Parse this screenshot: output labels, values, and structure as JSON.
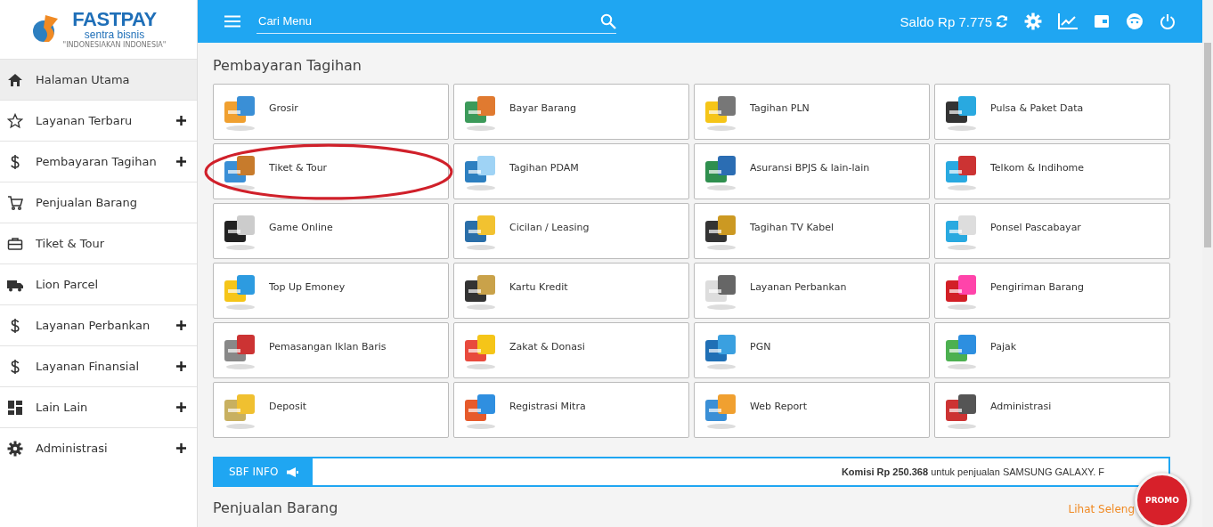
{
  "logo": {
    "name": "FASTPAY",
    "subtitle": "sentra bisnis",
    "tagline": "\"INDONESIAKAN INDONESIA\""
  },
  "sidebar": {
    "items": [
      {
        "label": "Halaman Utama",
        "selected": true,
        "expandable": false
      },
      {
        "label": "Layanan Terbaru",
        "selected": false,
        "expandable": true
      },
      {
        "label": "Pembayaran Tagihan",
        "selected": false,
        "expandable": true
      },
      {
        "label": "Penjualan Barang",
        "selected": false,
        "expandable": false
      },
      {
        "label": "Tiket & Tour",
        "selected": false,
        "expandable": false
      },
      {
        "label": "Lion Parcel",
        "selected": false,
        "expandable": false
      },
      {
        "label": "Layanan Perbankan",
        "selected": false,
        "expandable": true
      },
      {
        "label": "Layanan Finansial",
        "selected": false,
        "expandable": true
      },
      {
        "label": "Lain Lain",
        "selected": false,
        "expandable": true
      },
      {
        "label": "Administrasi",
        "selected": false,
        "expandable": true
      }
    ]
  },
  "topbar": {
    "search": {
      "placeholder": "Cari Menu"
    },
    "balance": "Saldo Rp 7.775"
  },
  "section": {
    "title": "Pembayaran Tagihan",
    "tiles": [
      {
        "label": "Grosir",
        "circled": false
      },
      {
        "label": "Bayar Barang",
        "circled": false
      },
      {
        "label": "Tagihan PLN",
        "circled": false
      },
      {
        "label": "Pulsa & Paket Data",
        "circled": false
      },
      {
        "label": "Tiket & Tour",
        "circled": true
      },
      {
        "label": "Tagihan PDAM",
        "circled": false
      },
      {
        "label": "Asuransi BPJS & lain-lain",
        "circled": false
      },
      {
        "label": "Telkom & Indihome",
        "circled": false
      },
      {
        "label": "Game Online",
        "circled": false
      },
      {
        "label": "Cicilan / Leasing",
        "circled": false
      },
      {
        "label": "Tagihan TV Kabel",
        "circled": false
      },
      {
        "label": "Ponsel Pascabayar",
        "circled": false
      },
      {
        "label": "Top Up Emoney",
        "circled": false
      },
      {
        "label": "Kartu Kredit",
        "circled": false
      },
      {
        "label": "Layanan Perbankan",
        "circled": false
      },
      {
        "label": "Pengiriman Barang",
        "circled": false
      },
      {
        "label": "Pemasangan Iklan Baris",
        "circled": false
      },
      {
        "label": "Zakat & Donasi",
        "circled": false
      },
      {
        "label": "PGN",
        "circled": false
      },
      {
        "label": "Pajak",
        "circled": false
      },
      {
        "label": "Deposit",
        "circled": false
      },
      {
        "label": "Registrasi Mitra",
        "circled": false
      },
      {
        "label": "Web Report",
        "circled": false
      },
      {
        "label": "Administrasi",
        "circled": false
      }
    ]
  },
  "info_bar": {
    "label": "SBF INFO",
    "message": "**Komisi Rp 250.368** untuk penjualan SAMSUNG GALAXY. F"
  },
  "next_section": {
    "title": "Penjualan Barang",
    "link": "Lihat Seleng"
  },
  "promo": {
    "label": "PROMO"
  }
}
